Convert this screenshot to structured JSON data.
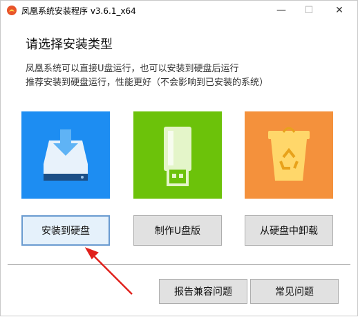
{
  "window": {
    "title": "凤凰系统安装程序 v3.6.1_x64",
    "minimize_glyph": "—",
    "maximize_glyph": "☐",
    "close_glyph": "✕"
  },
  "main": {
    "heading": "请选择安装类型",
    "description_line1": "凤凰系统可以直接U盘运行，也可以安装到硬盘后运行",
    "description_line2": "推荐安装到硬盘运行，性能更好（不会影响到已安装的系统）"
  },
  "options": [
    {
      "label": "安装到硬盘",
      "icon": "hard-drive-download-icon",
      "color": "#1d8df2"
    },
    {
      "label": "制作U盘版",
      "icon": "usb-drive-icon",
      "color": "#6cc20a"
    },
    {
      "label": "从硬盘中卸载",
      "icon": "recycle-bin-icon",
      "color": "#f4913c"
    }
  ],
  "footer": {
    "report_label": "报告兼容问题",
    "faq_label": "常见问题"
  },
  "annotation": {
    "arrow_color": "#e0201b"
  }
}
